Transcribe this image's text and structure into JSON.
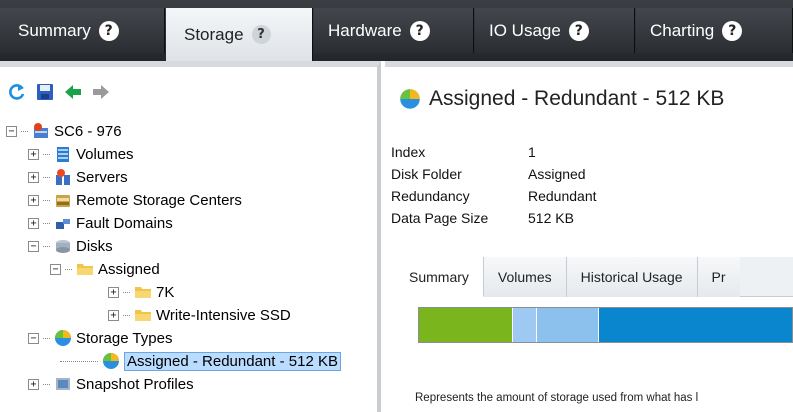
{
  "tabs": [
    {
      "label": "Summary",
      "active": false
    },
    {
      "label": "Storage",
      "active": true
    },
    {
      "label": "Hardware",
      "active": false
    },
    {
      "label": "IO Usage",
      "active": false
    },
    {
      "label": "Charting",
      "active": false
    }
  ],
  "help_glyph": "?",
  "toolbar": {
    "refresh_icon": "refresh-icon",
    "save_icon": "save-icon",
    "back_icon": "back-arrow-icon",
    "forward_icon": "forward-arrow-icon"
  },
  "tree": {
    "root": "SC6 - 976",
    "volumes": "Volumes",
    "servers": "Servers",
    "remote": "Remote Storage Centers",
    "fault": "Fault Domains",
    "disks": "Disks",
    "assigned": "Assigned",
    "k7": "7K",
    "ssd": "Write-Intensive SSD",
    "storage_types": "Storage Types",
    "selected": "Assigned - Redundant - 512 KB",
    "snapshot": "Snapshot Profiles",
    "collapse": "−",
    "expand": "+"
  },
  "detail": {
    "title": "Assigned - Redundant - 512 KB",
    "props": [
      {
        "key": "Index",
        "value": "1"
      },
      {
        "key": "Disk Folder",
        "value": "Assigned"
      },
      {
        "key": "Redundancy",
        "value": "Redundant"
      },
      {
        "key": "Data Page Size",
        "value": "512 KB"
      }
    ],
    "subtabs": [
      "Summary",
      "Volumes",
      "Historical Usage",
      "Pr"
    ],
    "usage_segments": [
      {
        "color": "#7ab51d",
        "fraction": 0.249
      },
      {
        "color": "#9ec9f2",
        "fraction": 0.064
      },
      {
        "color": "#8cc1ee",
        "fraction": 0.168
      },
      {
        "color": "#0a86cf",
        "fraction": 0.519
      }
    ],
    "note": "Represents the amount of storage used from what has l"
  },
  "colors": {
    "tabbar_dark": "#2a2d31",
    "selection": "#b9dcff",
    "accent_blue": "#0a86cf",
    "green": "#7ab51d"
  }
}
